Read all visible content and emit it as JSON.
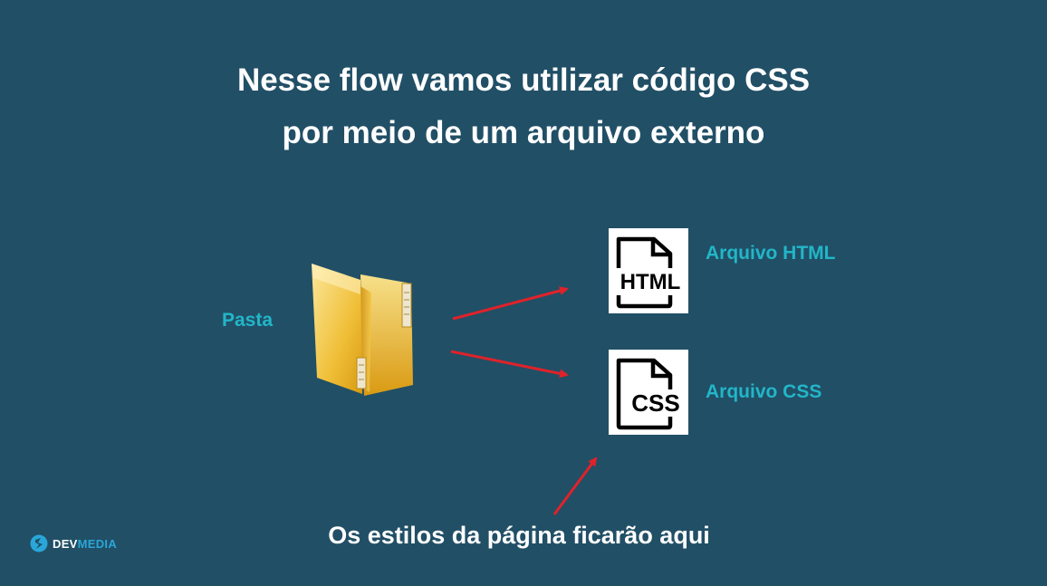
{
  "title": {
    "line1": "Nesse flow vamos utilizar código CSS",
    "line2": "por meio de um arquivo externo"
  },
  "nodes": {
    "folder_label": "Pasta",
    "html_file": {
      "icon_text": "HTML",
      "label": "Arquivo HTML"
    },
    "css_file": {
      "icon_text": "CSS",
      "label": "Arquivo CSS"
    }
  },
  "caption": "Os estilos da página ficarão aqui",
  "logo": {
    "part1": "DEV",
    "part2": "MEDIA"
  },
  "colors": {
    "background": "#214f66",
    "accent_label": "#22b6c8",
    "arrow": "#e0222a",
    "folder": "#f2c232"
  },
  "icons": [
    "folder-icon",
    "html-file-icon",
    "css-file-icon",
    "devmedia-logo-icon"
  ]
}
